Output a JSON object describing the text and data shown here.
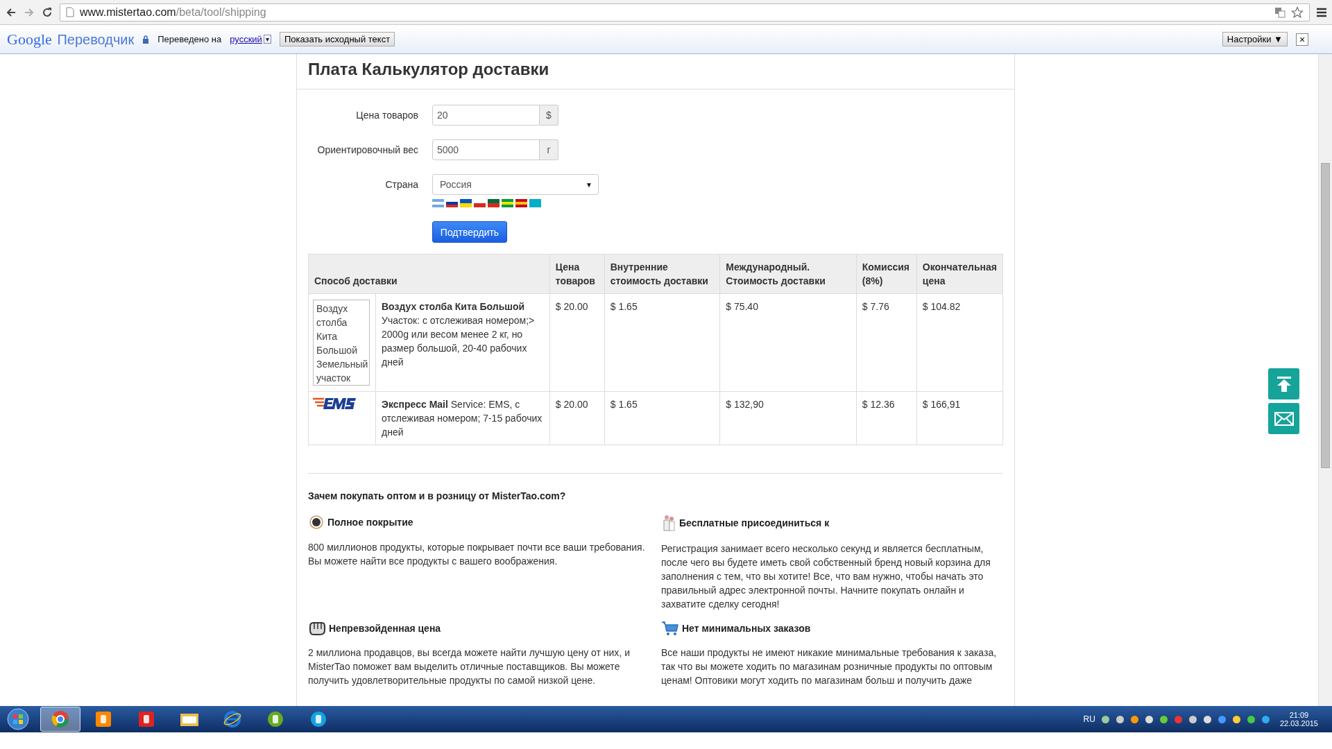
{
  "browser": {
    "url_domain": "www.mistertao.com",
    "url_path": "/beta/tool/shipping"
  },
  "translate_bar": {
    "brand_google": "Google",
    "brand_product": "Переводчик",
    "translated_to": "Переведено на",
    "language": "русский",
    "language_caret": "▾",
    "show_original": "Показать исходный текст",
    "settings": "Настройки ▼",
    "close": "×"
  },
  "page": {
    "title": "Плата Калькулятор доставки",
    "fields": [
      {
        "kind": "input",
        "label": "Цена товаров",
        "value": "20",
        "addon": "$"
      },
      {
        "kind": "input",
        "label": "Ориентировочный вес",
        "value": "5000",
        "addon": "г"
      },
      {
        "kind": "select",
        "label": "Страна",
        "value": "Россия",
        "caret": "▼"
      }
    ],
    "submit": "Подтвердить",
    "table": {
      "columns": [
        "Способ доставки",
        "Цена товаров",
        "Внутренние стоимость доставки",
        "Международный. Стоимость доставки",
        "Комиссия (8%)",
        "Окончательная цена"
      ],
      "rows": [
        {
          "cells": [
            {
              "kind": "broken-image",
              "image_alt": "Воздух столба Кита Большой Земельный участок",
              "title": "Воздух столба Кита Большой",
              "description": "Участок: с отслеживая номером;> 2000g или весом менее 2 кг, но размер большой, 20-40 рабочих дней"
            },
            "$ 20.00",
            "$ 1.65",
            "$ 75.40",
            "$ 7.76",
            "$ 104.82"
          ]
        },
        {
          "cells": [
            {
              "kind": "ems-logo",
              "description": "**Экспресс Mail** Service: EMS, с отслеживая номером; 7-15 рабочих дней"
            },
            "$ 20.00",
            "$ 1.65",
            "$ 132,90",
            "$ 12.36",
            "$ 166,91"
          ]
        }
      ]
    },
    "why": {
      "heading": "Зачем покупать оптом и в розницу от MisterTao.com?",
      "features": [
        {
          "title": "Полное покрытие",
          "text": "800 миллионов продукты, которые покрывает почти все ваши требования. Вы можете найти все продукты с вашего воображения."
        },
        {
          "title": "Бесплатные присоединиться к",
          "text": "Регистрация занимает всего несколько секунд и является бесплатным, после чего вы будете иметь свой собственный бренд новый корзина для заполнения с тем, что вы хотите! Все, что вам нужно, чтобы начать это правильный адрес электронной почты. Начните покупать онлайн и захватите сделку сегодня!"
        },
        {
          "title": "Непревзойденная цена",
          "text": "2 миллиона продавцов, вы всегда можете найти лучшую цену от них, и MisterTao поможет вам выделить отличные поставщиков. Вы можете получить удовлетворительные продукты по самой низкой цене."
        },
        {
          "title": "Нет минимальных заказов",
          "text": "Все наши продукты не имеют никакие минимальные требования к заказа, так что вы можете ходить по магазинам розничные продукты по оптовым ценам! Оптовики могут ходить по магазинам больш и получить даже"
        }
      ]
    }
  },
  "taskbar": {
    "apps": [
      {
        "selected": true
      },
      {
        "selected": false
      },
      {
        "selected": false
      },
      {
        "selected": false
      },
      {
        "selected": false
      },
      {
        "selected": false
      },
      {
        "selected": false
      }
    ],
    "language": "RU",
    "time": "21:09",
    "date": "22.03.2015"
  }
}
